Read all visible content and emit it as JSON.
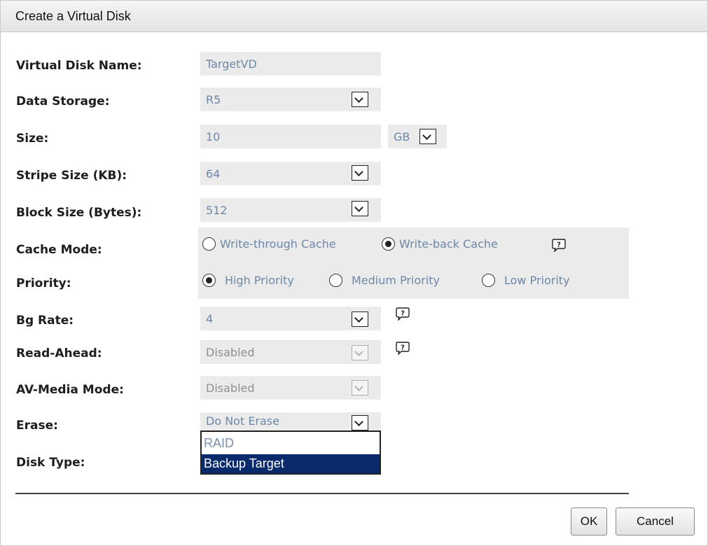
{
  "dialog": {
    "title": "Create a Virtual Disk"
  },
  "form": {
    "virtual_disk_name": {
      "label": "Virtual Disk Name:",
      "value": "TargetVD"
    },
    "data_storage": {
      "label": "Data Storage:",
      "value": "R5"
    },
    "size": {
      "label": "Size:",
      "value": "10",
      "unit": "GB"
    },
    "stripe_size": {
      "label": "Stripe Size (KB):",
      "value": "64"
    },
    "block_size": {
      "label": "Block Size (Bytes):",
      "value": "512"
    },
    "cache_mode": {
      "label": "Cache Mode:",
      "options": [
        {
          "label": "Write-through Cache",
          "checked": false
        },
        {
          "label": "Write-back Cache",
          "checked": true
        }
      ]
    },
    "priority": {
      "label": "Priority:",
      "options": [
        {
          "label": "High Priority",
          "checked": true
        },
        {
          "label": "Medium Priority",
          "checked": false
        },
        {
          "label": "Low Priority",
          "checked": false
        }
      ]
    },
    "bg_rate": {
      "label": "Bg Rate:",
      "value": "4"
    },
    "read_ahead": {
      "label": "Read-Ahead:",
      "value": "Disabled",
      "disabled": true
    },
    "av_media_mode": {
      "label": "AV-Media Mode:",
      "value": "Disabled",
      "disabled": true
    },
    "erase": {
      "label": "Erase:",
      "value": "Do Not Erase"
    },
    "disk_type": {
      "label": "Disk Type:",
      "options": [
        "RAID",
        "Backup Target"
      ],
      "selected": "Backup Target"
    }
  },
  "buttons": {
    "ok": "OK",
    "cancel": "Cancel"
  },
  "icons": {
    "dropdown": "chevron-down-icon",
    "help": "help-bubble-icon"
  },
  "colors": {
    "field_bg": "#ebebeb",
    "value_text": "#6d87a6",
    "selected_option_bg": "#0a2a6e"
  }
}
